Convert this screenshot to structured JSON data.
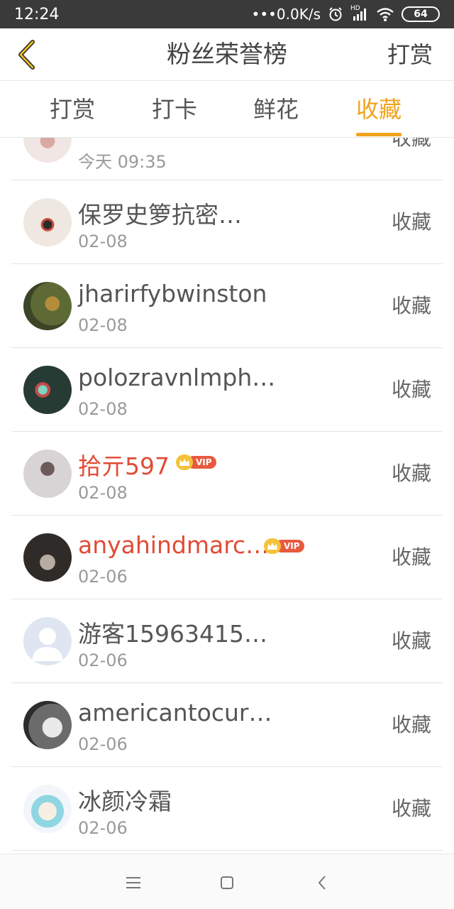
{
  "status_bar": {
    "time": "12:24",
    "network_speed": "•••0.0K/s",
    "hd_label": "HD",
    "battery": "64"
  },
  "header": {
    "title": "粉丝荣誉榜",
    "action_label": "打赏"
  },
  "tabs": [
    {
      "label": "打赏",
      "active": false
    },
    {
      "label": "打卡",
      "active": false
    },
    {
      "label": "鲜花",
      "active": false
    },
    {
      "label": "收藏",
      "active": true
    }
  ],
  "list": {
    "items": [
      {
        "name": "",
        "date": "今天 09:35",
        "action": "收藏",
        "vip": false
      },
      {
        "name": "保罗史箩抗密…",
        "date": "02-08",
        "action": "收藏",
        "vip": false
      },
      {
        "name": "jharirfybwinston",
        "date": "02-08",
        "action": "收藏",
        "vip": false
      },
      {
        "name": "polozravnlmph…",
        "date": "02-08",
        "action": "收藏",
        "vip": false
      },
      {
        "name": "拾亓597",
        "date": "02-08",
        "action": "收藏",
        "vip": true
      },
      {
        "name": "anyahindmarc…",
        "date": "02-06",
        "action": "收藏",
        "vip": true
      },
      {
        "name": "游客15963415…",
        "date": "02-06",
        "action": "收藏",
        "vip": false
      },
      {
        "name": "americantocur…",
        "date": "02-06",
        "action": "收藏",
        "vip": false
      },
      {
        "name": "冰颜冷霜",
        "date": "02-06",
        "action": "收藏",
        "vip": false
      }
    ]
  },
  "vip_label": "VIP",
  "colors": {
    "accent": "#f0a31c",
    "vip_name": "#e24b34",
    "status_bar": "#3a3a3a"
  }
}
